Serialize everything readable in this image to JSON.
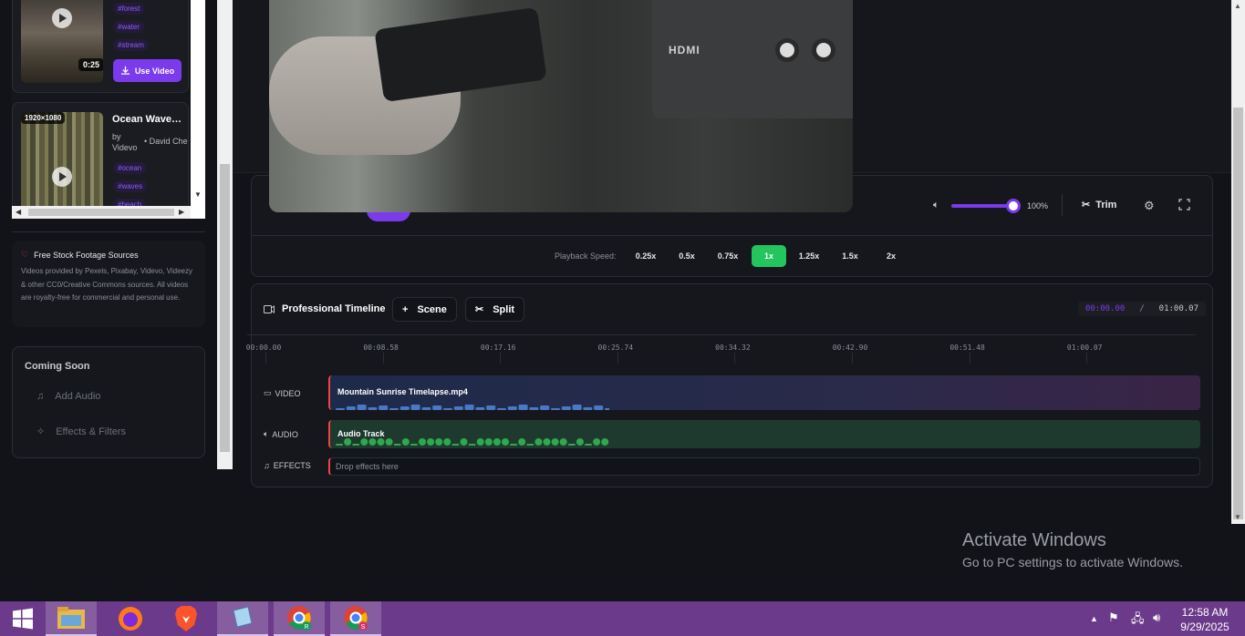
{
  "library": {
    "card1": {
      "duration": "0:25",
      "tags": [
        "#forest",
        "#water",
        "#stream"
      ],
      "use_button": "Use Video"
    },
    "card2": {
      "resolution": "1920×1080",
      "title": "Ocean Wave…",
      "by": "by",
      "source": "Videvo",
      "author": "• David Che",
      "tags": [
        "#ocean",
        "#waves",
        "#beach"
      ]
    }
  },
  "info": {
    "title": "Free Stock Footage Sources",
    "description": "Videos provided by Pexels, Pixabay, Videvo, Videezy & other CC0/Creative Commons sources. All videos are royalty-free for commercial and personal use."
  },
  "coming_soon": {
    "title": "Coming Soon",
    "items": [
      "Add Audio",
      "Effects & Filters"
    ]
  },
  "player": {
    "hdmi_label": "HDMI",
    "volume_percent": "100%",
    "volume_level": 1.0,
    "trim_label": "Trim",
    "speed_label": "Playback Speed:",
    "speeds": [
      "0.25x",
      "0.5x",
      "0.75x",
      "1x",
      "1.25x",
      "1.5x",
      "2x"
    ],
    "active_speed": "1x"
  },
  "timeline": {
    "title": "Professional Timeline",
    "scene_button": "Scene",
    "split_button": "Split",
    "current_time": "00:00.00",
    "separator": "/",
    "total_time": "01:00.07",
    "ruler": [
      "00:00.00",
      "00:08.58",
      "00:17.16",
      "00:25.74",
      "00:34.32",
      "00:42.90",
      "00:51.48",
      "01:00.07"
    ],
    "tracks": {
      "video_label": "VIDEO",
      "video_clip": "Mountain Sunrise Timelapse.mp4",
      "audio_label": "AUDIO",
      "audio_clip": "Audio Track",
      "effects_label": "EFFECTS",
      "effects_placeholder": "Drop effects here"
    }
  },
  "watermark": {
    "title": "Activate Windows",
    "subtitle": "Go to PC settings to activate Windows."
  },
  "taskbar": {
    "time": "12:58 AM",
    "date": "9/29/2025"
  },
  "colors": {
    "accent": "#7c3aed",
    "active_speed": "#22c55e",
    "taskbar": "#6c3a8a"
  }
}
